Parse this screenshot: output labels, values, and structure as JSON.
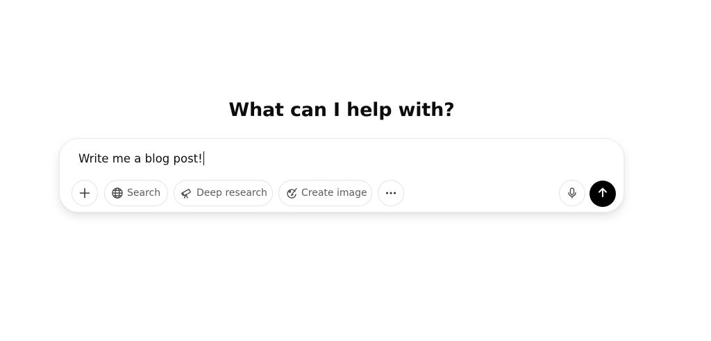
{
  "page": {
    "heading": "What can I help with?"
  },
  "composer": {
    "input_value": "Write me a blog post!",
    "attach_icon": "plus-icon",
    "tools": [
      {
        "label": "Search",
        "icon": "globe-icon"
      },
      {
        "label": "Deep research",
        "icon": "telescope-icon"
      },
      {
        "label": "Create image",
        "icon": "image-brush-icon"
      }
    ],
    "more_icon": "ellipsis-icon",
    "mic_icon": "microphone-icon",
    "send_icon": "arrow-up-icon"
  },
  "colors": {
    "background": "#ffffff",
    "text": "#0d0d0d",
    "muted_text": "#5d5d5d",
    "border": "#e3e3e3",
    "send_button": "#000000"
  }
}
